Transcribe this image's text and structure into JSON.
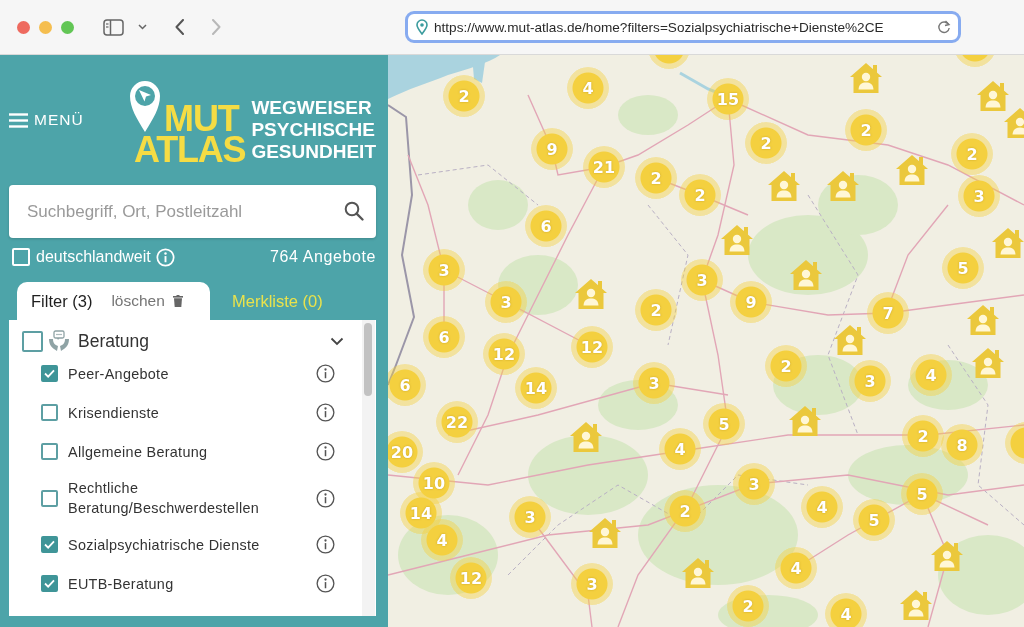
{
  "browser": {
    "nav": [
      {
        "kind": "back",
        "disabled": false
      },
      {
        "kind": "forward",
        "disabled": true
      }
    ],
    "url": "https://www.mut-atlas.de/home?filters=Sozialpsychiatrische+Dienste%2CE"
  },
  "sidebar": {
    "menu_label": "MENÜ",
    "logo": {
      "name_lines": [
        "MUT",
        "ATLAS"
      ],
      "tagline_lines": [
        "WEGWEISER",
        "PSYCHISCHE",
        "GESUNDHEIT"
      ]
    },
    "search": {
      "placeholder": "Suchbegriff, Ort, Postleitzahl"
    },
    "nationwide": {
      "label": "deutschlandweit",
      "checked": false
    },
    "result_count": "764 Angebote",
    "tabs": [
      {
        "label": "Filter (3)",
        "selected": true,
        "action": "löschen"
      },
      {
        "label": "Merkliste (0)",
        "selected": false
      }
    ],
    "categories": [
      {
        "label": "Beratung",
        "checked": false,
        "expanded": true,
        "children": [
          {
            "label": "Peer-Angebote",
            "checked": true
          },
          {
            "label": "Krisendienste",
            "checked": false
          },
          {
            "label": "Allgemeine Beratung",
            "checked": false
          },
          {
            "label": "Rechtliche Beratung/Beschwerdestellen",
            "checked": false
          },
          {
            "label": "Sozialpsychiatrische Dienste",
            "checked": true
          },
          {
            "label": "EUTB-Beratung",
            "checked": true
          }
        ]
      }
    ]
  },
  "map": {
    "markers": [
      {
        "kind": "cluster",
        "count": "2"
      },
      {
        "kind": "cluster",
        "count": "4"
      },
      {
        "kind": "cluster",
        "count": "15"
      },
      {
        "kind": "cluster",
        "count": "9"
      },
      {
        "kind": "cluster",
        "count": "21"
      },
      {
        "kind": "cluster",
        "count": "2"
      },
      {
        "kind": "cluster",
        "count": "2"
      },
      {
        "kind": "cluster",
        "count": "2"
      },
      {
        "kind": "cluster",
        "count": "2"
      },
      {
        "kind": "cluster",
        "count": "2"
      },
      {
        "kind": "cluster",
        "count": "3"
      },
      {
        "kind": "cluster",
        "count": "6"
      },
      {
        "kind": "cluster",
        "count": "3"
      },
      {
        "kind": "cluster",
        "count": "3"
      },
      {
        "kind": "cluster",
        "count": "2"
      },
      {
        "kind": "cluster",
        "count": "3"
      },
      {
        "kind": "cluster",
        "count": "9"
      },
      {
        "kind": "cluster",
        "count": "7"
      },
      {
        "kind": "cluster",
        "count": "5"
      },
      {
        "kind": "cluster",
        "count": "6"
      },
      {
        "kind": "cluster",
        "count": "12"
      },
      {
        "kind": "cluster",
        "count": "12"
      },
      {
        "kind": "cluster",
        "count": "14"
      },
      {
        "kind": "cluster",
        "count": "3"
      },
      {
        "kind": "cluster",
        "count": "2"
      },
      {
        "kind": "cluster",
        "count": "3"
      },
      {
        "kind": "cluster",
        "count": "4"
      },
      {
        "kind": "cluster",
        "count": "6"
      },
      {
        "kind": "cluster",
        "count": "22"
      },
      {
        "kind": "cluster",
        "count": "20"
      },
      {
        "kind": "cluster",
        "count": "5"
      },
      {
        "kind": "cluster",
        "count": "4"
      },
      {
        "kind": "cluster",
        "count": "2"
      },
      {
        "kind": "cluster",
        "count": "8"
      },
      {
        "kind": "cluster",
        "count": "10"
      },
      {
        "kind": "cluster",
        "count": "14"
      },
      {
        "kind": "cluster",
        "count": "3"
      },
      {
        "kind": "cluster",
        "count": "3"
      },
      {
        "kind": "cluster",
        "count": "2"
      },
      {
        "kind": "cluster",
        "count": "4"
      },
      {
        "kind": "cluster",
        "count": "5"
      },
      {
        "kind": "cluster",
        "count": "5"
      },
      {
        "kind": "cluster",
        "count": "4"
      },
      {
        "kind": "cluster",
        "count": "12"
      },
      {
        "kind": "cluster",
        "count": "3"
      },
      {
        "kind": "cluster",
        "count": "4"
      },
      {
        "kind": "cluster",
        "count": "2"
      },
      {
        "kind": "cluster",
        "count": "4"
      },
      {
        "kind": "house"
      },
      {
        "kind": "house"
      },
      {
        "kind": "house"
      },
      {
        "kind": "house"
      },
      {
        "kind": "house"
      },
      {
        "kind": "house"
      },
      {
        "kind": "house"
      },
      {
        "kind": "house"
      },
      {
        "kind": "house"
      },
      {
        "kind": "house"
      },
      {
        "kind": "house"
      },
      {
        "kind": "house"
      },
      {
        "kind": "house"
      },
      {
        "kind": "house"
      },
      {
        "kind": "house"
      },
      {
        "kind": "house"
      },
      {
        "kind": "house"
      },
      {
        "kind": "house"
      },
      {
        "kind": "cluster"
      },
      {
        "kind": "cluster"
      },
      {
        "kind": "cluster"
      },
      {
        "kind": "house"
      }
    ]
  }
}
